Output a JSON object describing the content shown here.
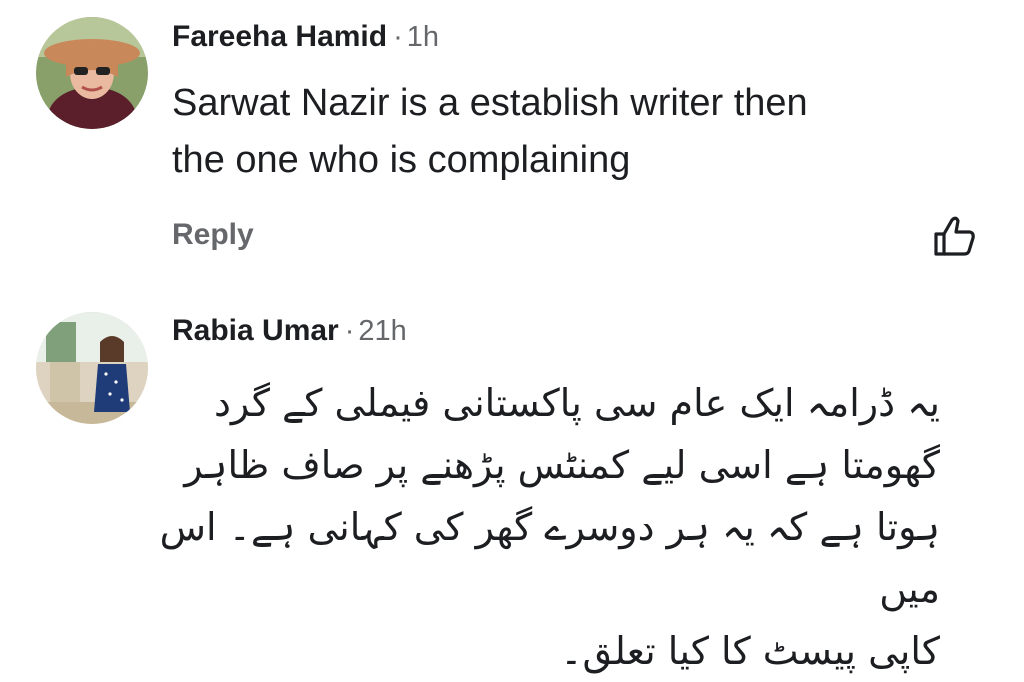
{
  "comments": [
    {
      "author": "Fareeha Hamid",
      "time": "1h",
      "separator": "·",
      "lines": [
        "Sarwat Nazir is a establish writer then",
        "the one who is complaining"
      ],
      "reply_label": "Reply",
      "like_icon": "thumbs-up-icon"
    },
    {
      "author": "Rabia Umar",
      "time": "21h",
      "separator": "·",
      "lines": [
        "یہ ڈرامہ ایک عام سی پاکستانی فیملی کے گرد",
        "گھومتا ہے اسی لیے کمنٹس پڑھنے پر صاف ظاہر",
        "ہوتا ہے کہ یہ ہر دوسرے گھر کی کہانی ہے۔ اس میں",
        "کاپی پیسٹ کا کیا تعلق۔"
      ]
    }
  ]
}
